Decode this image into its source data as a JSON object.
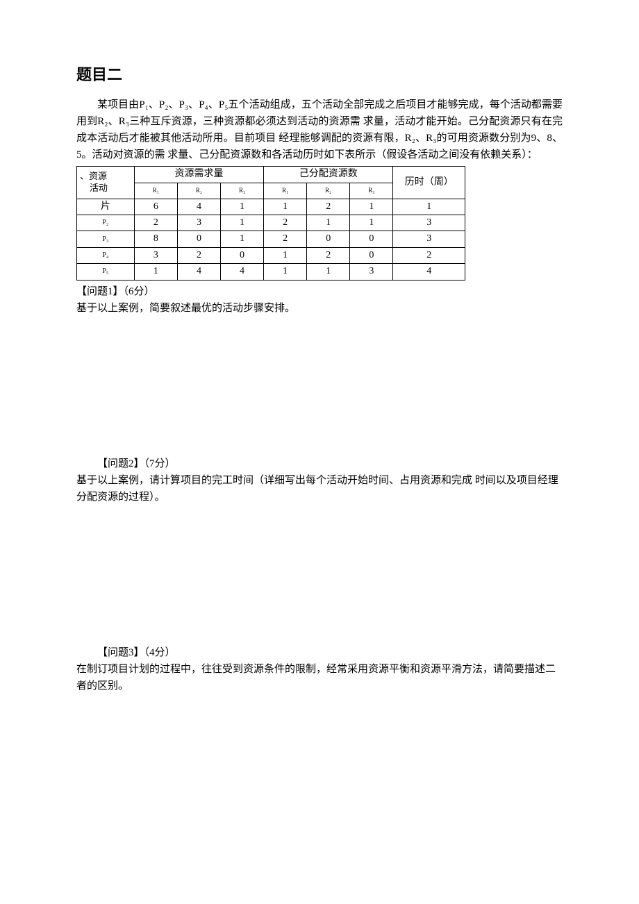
{
  "title": "题目二",
  "intro": "某项目由P₁、P₂、P₃、P₄、P₅五个活动组成，五个活动全部完成之后项目才能够完成，每个活动都需要用到R₂、R₃三种互斥资源，三种资源都必须达到活动的资源需 求量，活动才能开始。己分配资源只有在完成本活动后才能被其他活动所用。目前项目 经理能够调配的资源有限，R₂、R₃的可用资源数分别为9、8、5。活动对资源的需 求量、己分配资源数和各活动历时如下表所示（假设各活动之间没有依赖关系）：",
  "table": {
    "corner_top": "、资源",
    "corner_bottom": "活动",
    "header_demand": "资源需求量",
    "header_alloc": "己分配资源数",
    "header_time": "历时（周）",
    "sub": {
      "r1": "R₁",
      "r2": "R₂",
      "r3": "R₃"
    },
    "rows": [
      {
        "name": "片",
        "d1": "6",
        "d2": "4",
        "d3": "1",
        "a1": "1",
        "a2": "2",
        "a3": "1",
        "t": "1"
      },
      {
        "name": "P₂",
        "d1": "2",
        "d2": "3",
        "d3": "1",
        "a1": "2",
        "a2": "1",
        "a3": "1",
        "t": "3"
      },
      {
        "name": "P₃",
        "d1": "8",
        "d2": "0",
        "d3": "1",
        "a1": "2",
        "a2": "0",
        "a3": "0",
        "t": "3"
      },
      {
        "name": "P₄",
        "d1": "3",
        "d2": "2",
        "d3": "0",
        "a1": "1",
        "a2": "2",
        "a3": "0",
        "t": "2"
      },
      {
        "name": "P₅",
        "d1": "1",
        "d2": "4",
        "d3": "4",
        "a1": "1",
        "a2": "1",
        "a3": "3",
        "t": "4"
      }
    ]
  },
  "q1": {
    "head": "【问题1】（6分）",
    "body": "基于以上案例，简要叙述最优的活动步骤安排。"
  },
  "q2": {
    "head": "【问题2】（7分）",
    "body": "基于以上案例，请计算项目的完工时间（详细写出每个活动开始时间、占用资源和完成 时间以及项目经理分配资源的过程）。"
  },
  "q3": {
    "head": "【问题3】（4分）",
    "body": "在制订项目计划的过程中，往往受到资源条件的限制，经常采用资源平衡和资源平滑方法，请简要描述二者的区别。"
  }
}
